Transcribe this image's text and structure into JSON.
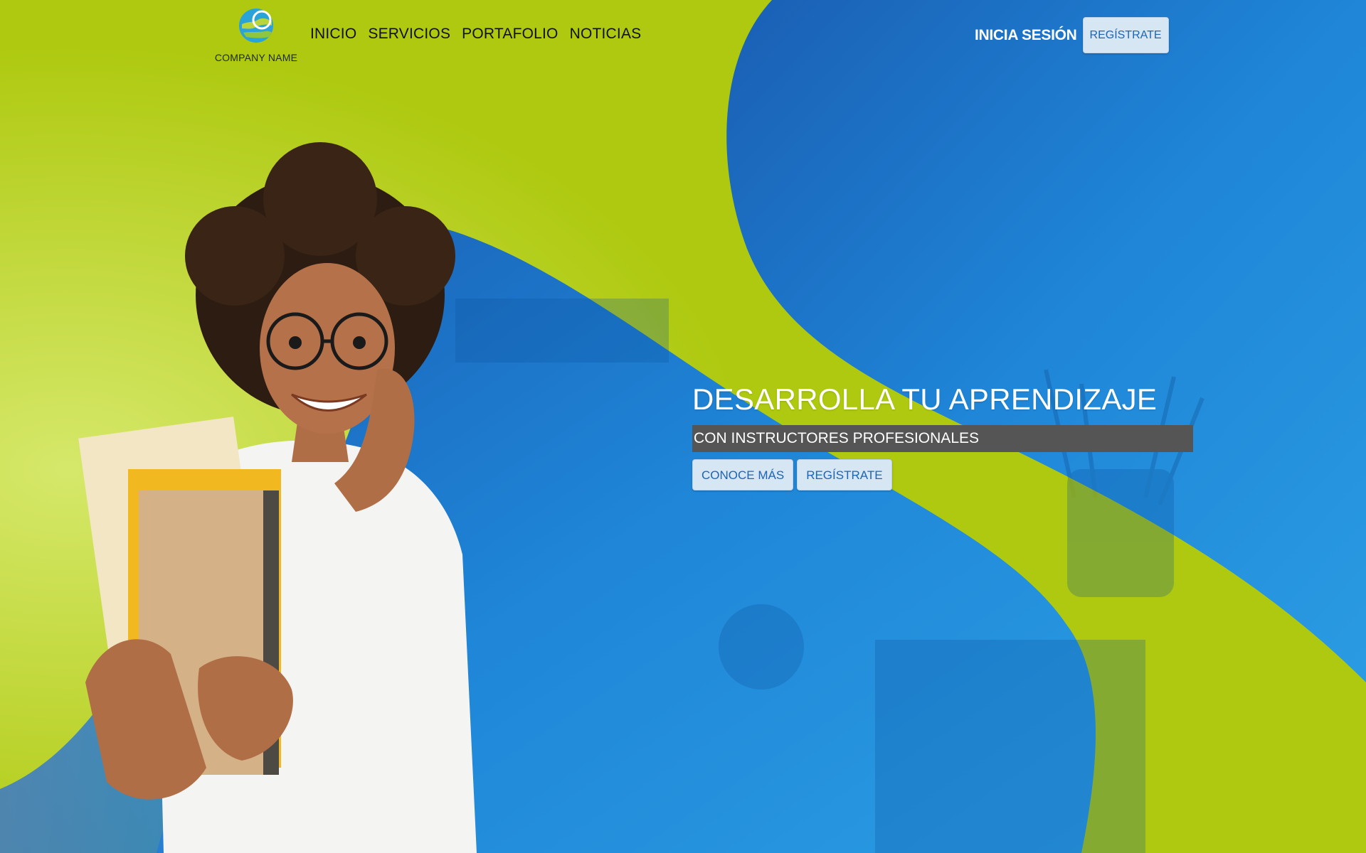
{
  "logo": {
    "company_name": "COMPANY NAME"
  },
  "nav": {
    "items": [
      "INICIO",
      "SERVICIOS",
      "PORTAFOLIO",
      "NOTICIAS"
    ]
  },
  "auth": {
    "login_label": "INICIA SESIÓN",
    "register_label": "REGÍSTRATE"
  },
  "hero": {
    "title": "DESARROLLA TU APRENDIZAJE",
    "subtitle": "CON INSTRUCTORES PROFESIONALES",
    "learn_more_label": "CONOCE MÁS",
    "register_label": "REGÍSTRATE"
  },
  "colors": {
    "lime": "#aec90f",
    "blue": "#1f84d6",
    "dark_blue": "#0a4fa0",
    "button_bg": "#d7e6f3",
    "button_text": "#1d64b3",
    "subtitle_bg": "#555555"
  },
  "icons": {
    "logo": "globe-logo-icon"
  }
}
